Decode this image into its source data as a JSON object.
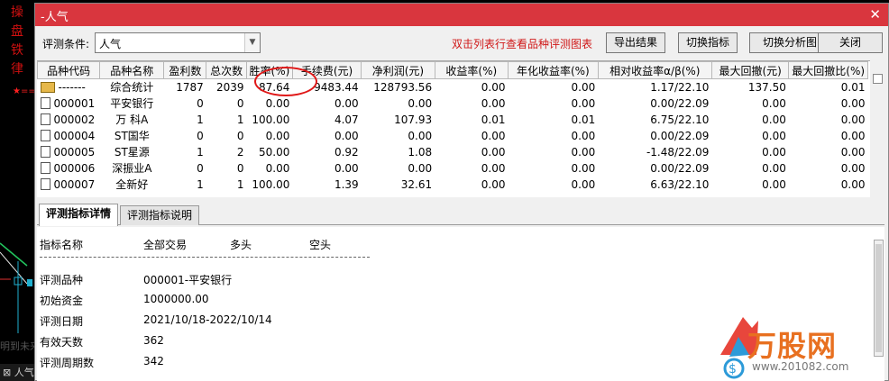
{
  "background_app": {
    "vertical_text": [
      "操",
      "盘",
      "铁",
      "律"
    ],
    "star": "★==",
    "bottom_tab": "人气",
    "ghost_text": "明到未来"
  },
  "window": {
    "title": "-人气",
    "close_symbol": "✕"
  },
  "toolbar": {
    "condition_label": "评测条件:",
    "condition_value": "人气",
    "hint": "双击列表行查看品种评测图表",
    "export_label": "导出结果",
    "switch_indicator_label": "切换指标",
    "switch_chart_label": "切换分析图",
    "close_label": "关闭"
  },
  "table": {
    "headers": [
      "品种代码",
      "品种名称",
      "盈利数",
      "总次数",
      "胜率(%)",
      "手续费(元)",
      "净利润(元)",
      "收益率(%)",
      "年化收益率(%)",
      "相对收益率α/β(%)",
      "最大回撤(元)",
      "最大回撤比(%)"
    ],
    "rows": [
      {
        "code": "-------",
        "name": "综合统计",
        "win": "1787",
        "total": "2039",
        "rate": "87.64",
        "fee": "9483.44",
        "profit": "128793.56",
        "ret": "0.00",
        "annual": "0.00",
        "relative": "1.17/22.10",
        "maxdd": "137.50",
        "maxddr": "0.01",
        "summary": true
      },
      {
        "code": "000001",
        "name": "平安银行",
        "win": "0",
        "total": "0",
        "rate": "0.00",
        "fee": "0.00",
        "profit": "0.00",
        "ret": "0.00",
        "annual": "0.00",
        "relative": "0.00/22.09",
        "maxdd": "0.00",
        "maxddr": "0.00"
      },
      {
        "code": "000002",
        "name": "万 科A",
        "win": "1",
        "total": "1",
        "rate": "100.00",
        "fee": "4.07",
        "profit": "107.93",
        "ret": "0.01",
        "annual": "0.01",
        "relative": "6.75/22.10",
        "maxdd": "0.00",
        "maxddr": "0.00"
      },
      {
        "code": "000004",
        "name": "ST国华",
        "win": "0",
        "total": "0",
        "rate": "0.00",
        "fee": "0.00",
        "profit": "0.00",
        "ret": "0.00",
        "annual": "0.00",
        "relative": "0.00/22.09",
        "maxdd": "0.00",
        "maxddr": "0.00"
      },
      {
        "code": "000005",
        "name": "ST星源",
        "win": "1",
        "total": "2",
        "rate": "50.00",
        "fee": "0.92",
        "profit": "1.08",
        "ret": "0.00",
        "annual": "0.00",
        "relative": "-1.48/22.09",
        "maxdd": "0.00",
        "maxddr": "0.00"
      },
      {
        "code": "000006",
        "name": "深振业A",
        "win": "0",
        "total": "0",
        "rate": "0.00",
        "fee": "0.00",
        "profit": "0.00",
        "ret": "0.00",
        "annual": "0.00",
        "relative": "0.00/22.09",
        "maxdd": "0.00",
        "maxddr": "0.00"
      },
      {
        "code": "000007",
        "name": "全新好",
        "win": "1",
        "total": "1",
        "rate": "100.00",
        "fee": "1.39",
        "profit": "32.61",
        "ret": "0.00",
        "annual": "0.00",
        "relative": "6.63/22.10",
        "maxdd": "0.00",
        "maxddr": "0.00"
      }
    ]
  },
  "tabs": {
    "detail_label": "评测指标详情",
    "desc_label": "评测指标说明"
  },
  "detail": {
    "header": {
      "name": "指标名称",
      "all": "全部交易",
      "long": "多头",
      "short": "空头"
    },
    "separator": "-------------------------------------------------------------------------------------------",
    "rows": [
      {
        "label": "评测品种",
        "value": "000001-平安银行"
      },
      {
        "label": "初始资金",
        "value": "1000000.00"
      },
      {
        "label": "评测日期",
        "value": "2021/10/18-2022/10/14"
      },
      {
        "label": "有效天数",
        "value": "362"
      },
      {
        "label": "评测周期数",
        "value": " 342"
      }
    ]
  },
  "watermark": {
    "brand": "万股网",
    "url": "www.201082.com"
  },
  "colors": {
    "titlebar": "#d9363e",
    "hint": "#d01818",
    "highlight_circle": "#e01818",
    "watermark": "#e87020"
  }
}
